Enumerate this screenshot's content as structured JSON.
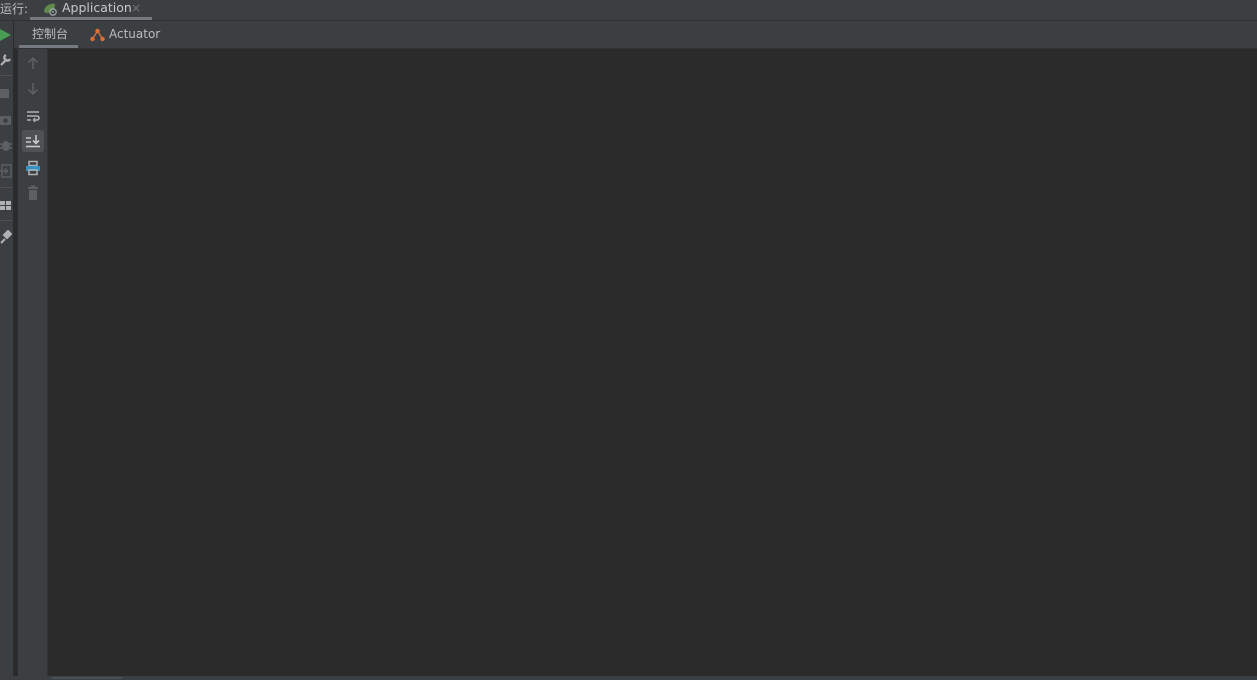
{
  "run_panel": {
    "label": "运行:",
    "tab": {
      "name": "Application",
      "close_glyph": "×",
      "icon": "spring-boot-app-icon"
    }
  },
  "side_toolbar": {
    "icons": [
      "rerun-icon",
      "wrench-icon",
      "stop-icon",
      "camera-icon",
      "debug-icon",
      "exit-icon",
      "layout-icon",
      "pin-icon"
    ]
  },
  "subtabs": {
    "console": "控制台",
    "actuator": "Actuator"
  },
  "console_toolbar": {
    "buttons": [
      "up-arrow-icon",
      "down-arrow-icon",
      "soft-wrap-icon",
      "scroll-to-end-icon",
      "print-icon",
      "trash-icon"
    ]
  },
  "colors": {
    "background": "#2b2b2b",
    "panel": "#3c3f41",
    "run_green": "#499c54",
    "print_blue": "#3592c4",
    "actuator_orange": "#d9703a"
  }
}
